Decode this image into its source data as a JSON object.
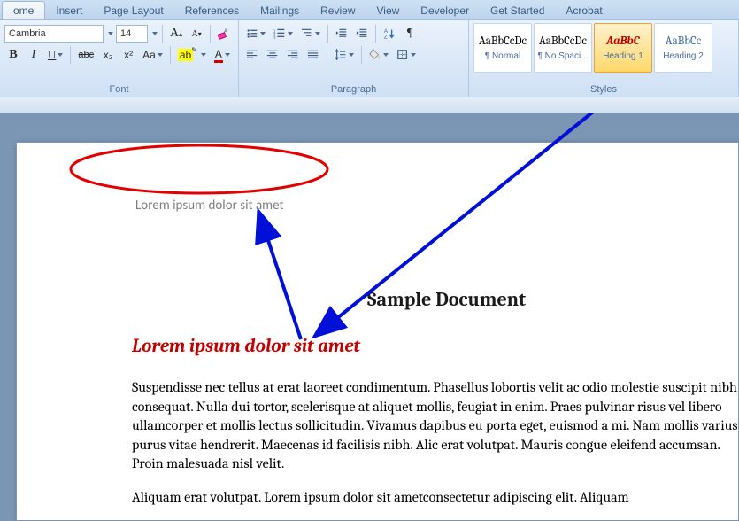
{
  "tabs": {
    "home": "ome",
    "insert": "Insert",
    "page_layout": "Page Layout",
    "references": "References",
    "mailings": "Mailings",
    "review": "Review",
    "view": "View",
    "developer": "Developer",
    "get_started": "Get Started",
    "acrobat": "Acrobat"
  },
  "font": {
    "name": "Cambria",
    "size": "14",
    "group_label": "Font",
    "grow": "A",
    "shrink": "A",
    "clear": "Aa",
    "bold": "B",
    "italic": "I",
    "underline": "U",
    "strike": "abc",
    "subscript": "x₂",
    "superscript": "x²",
    "changecase": "Aa",
    "highlight": "ab",
    "fontcolor": "A"
  },
  "paragraph": {
    "group_label": "Paragraph"
  },
  "styles": {
    "group_label": "Styles",
    "items": [
      {
        "sample": "AaBbCcDc",
        "name": "¶ Normal",
        "color": "#000000"
      },
      {
        "sample": "AaBbCcDc",
        "name": "¶ No Spaci...",
        "color": "#000000"
      },
      {
        "sample": "AaBbC",
        "name": "Heading 1",
        "color": "#c30000",
        "italic": true,
        "selected": true
      },
      {
        "sample": "AaBbCc",
        "name": "Heading 2",
        "color": "#3a6aa8"
      }
    ]
  },
  "document": {
    "header": "Lorem ipsum dolor sit amet",
    "title": "Sample Document",
    "h1": "Lorem ipsum dolor sit amet",
    "p1": "Suspendisse nec tellus at erat laoreet condimentum. Phasellus lobortis velit ac odio molestie suscipit nibh consequat. Nulla dui tortor, scelerisque at aliquet mollis, feugiat in enim. Praes pulvinar risus vel libero ullamcorper et mollis lectus sollicitudin. Vivamus dapibus eu porta eget, euismod a mi. Nam mollis varius purus vitae hendrerit. Maecenas id facilisis nibh. Alic erat volutpat. Mauris congue eleifend accumsan. Proin malesuada nisl velit.",
    "p2": "Aliquam erat volutpat. Lorem ipsum dolor sit ametconsectetur adipiscing elit. Aliquam"
  }
}
